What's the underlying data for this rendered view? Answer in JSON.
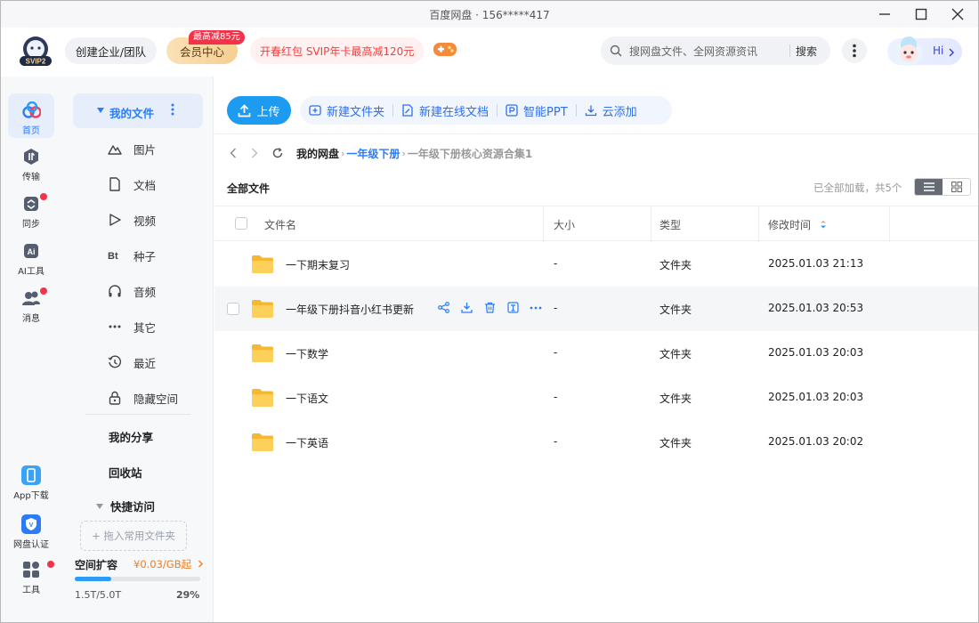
{
  "window": {
    "title": "百度网盘 · 156*****417"
  },
  "header": {
    "svip_badge": "SVIP2",
    "team_button": "创建企业/团队",
    "vip_button": "会员中心",
    "vip_badge": "最高减85元",
    "promo": "开春红包 SVIP年卡最高减120元",
    "search_placeholder": "搜网盘文件、全网资源资讯",
    "search_button": "搜索",
    "greeting": "Hi"
  },
  "rail": {
    "items": [
      {
        "label": "首页",
        "icon": "cloud-home-icon",
        "active": true
      },
      {
        "label": "传输",
        "icon": "transfer-icon",
        "active": false
      },
      {
        "label": "同步",
        "icon": "sync-icon",
        "active": false
      },
      {
        "label": "AI工具",
        "icon": "ai-icon",
        "active": false
      },
      {
        "label": "消息",
        "icon": "message-icon",
        "active": false
      }
    ],
    "bottom": [
      {
        "label": "App下载",
        "icon": "phone-icon"
      },
      {
        "label": "网盘认证",
        "icon": "verify-icon"
      },
      {
        "label": "工具",
        "icon": "tools-icon"
      }
    ]
  },
  "nav": {
    "my_files": "我的文件",
    "categories": [
      {
        "label": "图片",
        "icon": "image-icon"
      },
      {
        "label": "文档",
        "icon": "document-icon"
      },
      {
        "label": "视频",
        "icon": "video-icon"
      },
      {
        "label": "种子",
        "icon": "torrent-icon"
      },
      {
        "label": "音频",
        "icon": "audio-icon"
      },
      {
        "label": "其它",
        "icon": "more-icon"
      },
      {
        "label": "最近",
        "icon": "recent-icon"
      },
      {
        "label": "隐藏空间",
        "icon": "lock-icon"
      }
    ],
    "my_share": "我的分享",
    "recycle": "回收站",
    "quick_access": "快捷访问",
    "drop_hint": "+ 拖入常用文件夹",
    "storage": {
      "title": "空间扩容",
      "price": "¥0.03/GB起",
      "used": "1.5T/5.0T",
      "percent": "29%",
      "fraction": 0.29
    }
  },
  "toolbar": {
    "upload": "上传",
    "new_folder": "新建文件夹",
    "new_online_doc": "新建在线文档",
    "smart_ppt": "智能PPT",
    "cloud_add": "云添加"
  },
  "breadcrumb": {
    "root": "我的网盘",
    "mid": "一年级下册",
    "last": "一年级下册核心资源合集1"
  },
  "list": {
    "title": "全部文件",
    "status": "已全部加载，共5个",
    "columns": {
      "name": "文件名",
      "size": "大小",
      "type": "类型",
      "modified": "修改时间"
    },
    "rows": [
      {
        "name": "一下期末复习",
        "size": "-",
        "type": "文件夹",
        "modified": "2025.01.03 21:13"
      },
      {
        "name": "一年级下册抖音小红书更新",
        "size": "-",
        "type": "文件夹",
        "modified": "2025.01.03 20:53"
      },
      {
        "name": "一下数学",
        "size": "-",
        "type": "文件夹",
        "modified": "2025.01.03 20:03"
      },
      {
        "name": "一下语文",
        "size": "-",
        "type": "文件夹",
        "modified": "2025.01.03 20:03"
      },
      {
        "name": "一下英语",
        "size": "-",
        "type": "文件夹",
        "modified": "2025.01.03 20:02"
      }
    ]
  },
  "colors": {
    "accent": "#2c7cf6",
    "upload": "#1d9bf0",
    "promo": "#f33f3f",
    "folder": "#f8c237"
  }
}
